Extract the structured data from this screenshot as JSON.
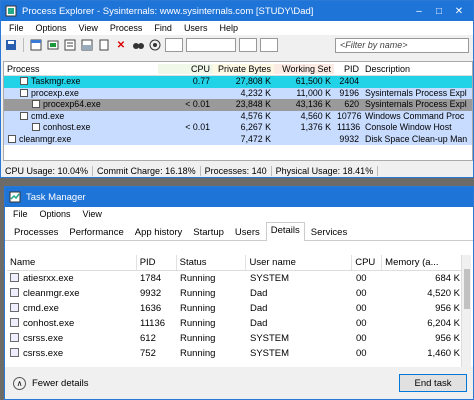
{
  "procexp": {
    "title": "Process Explorer - Sysinternals: www.sysinternals.com [STUDY\\Dad]",
    "menu": [
      "File",
      "Options",
      "View",
      "Process",
      "Find",
      "Users",
      "Help"
    ],
    "filter_placeholder": "<Filter by name>",
    "columns": [
      "Process",
      "CPU",
      "Private Bytes",
      "Working Set",
      "PID",
      "Description"
    ],
    "rows": [
      {
        "name": "Taskmgr.exe",
        "cpu": "0.77",
        "priv": "27,808 K",
        "ws": "61,500 K",
        "pid": "2404",
        "desc": "",
        "bg": "#22d3e8",
        "indent": 1
      },
      {
        "name": "procexp.exe",
        "cpu": "",
        "priv": "4,232 K",
        "ws": "11,000 K",
        "pid": "9196",
        "desc": "Sysinternals Process Expl",
        "bg": "#c8dcff",
        "indent": 1
      },
      {
        "name": "procexp64.exe",
        "cpu": "< 0.01",
        "priv": "23,848 K",
        "ws": "43,136 K",
        "pid": "620",
        "desc": "Sysinternals Process Expl",
        "bg": "#9a9a9a",
        "indent": 2
      },
      {
        "name": "cmd.exe",
        "cpu": "",
        "priv": "4,576 K",
        "ws": "4,560 K",
        "pid": "10776",
        "desc": "Windows Command Proc",
        "bg": "#c8dcff",
        "indent": 1
      },
      {
        "name": "conhost.exe",
        "cpu": "< 0.01",
        "priv": "6,267 K",
        "ws": "1,376 K",
        "pid": "11136",
        "desc": "Console Window Host",
        "bg": "#c8dcff",
        "indent": 2
      },
      {
        "name": "cleanmgr.exe",
        "cpu": "",
        "priv": "7,472 K",
        "ws": "",
        "pid": "9932",
        "desc": "Disk Space Clean-up Man",
        "bg": "#c8dcff",
        "indent": 0
      }
    ],
    "status": {
      "cpu": "CPU Usage: 10.04%",
      "commit": "Commit Charge: 16.18%",
      "processes": "Processes: 140",
      "physical": "Physical Usage: 18.41%"
    }
  },
  "taskmgr": {
    "title": "Task Manager",
    "menu": [
      "File",
      "Options",
      "View"
    ],
    "tabs": [
      "Processes",
      "Performance",
      "App history",
      "Startup",
      "Users",
      "Details",
      "Services"
    ],
    "active_tab": "Details",
    "columns": [
      "Name",
      "PID",
      "Status",
      "User name",
      "CPU",
      "Memory (a..."
    ],
    "rows": [
      {
        "name": "atiesrxx.exe",
        "pid": "1784",
        "status": "Running",
        "user": "SYSTEM",
        "cpu": "00",
        "mem": "684 K"
      },
      {
        "name": "cleanmgr.exe",
        "pid": "9932",
        "status": "Running",
        "user": "Dad",
        "cpu": "00",
        "mem": "4,520 K"
      },
      {
        "name": "cmd.exe",
        "pid": "1636",
        "status": "Running",
        "user": "Dad",
        "cpu": "00",
        "mem": "956 K"
      },
      {
        "name": "conhost.exe",
        "pid": "11136",
        "status": "Running",
        "user": "Dad",
        "cpu": "00",
        "mem": "6,204 K"
      },
      {
        "name": "csrss.exe",
        "pid": "612",
        "status": "Running",
        "user": "SYSTEM",
        "cpu": "00",
        "mem": "956 K"
      },
      {
        "name": "csrss.exe",
        "pid": "752",
        "status": "Running",
        "user": "SYSTEM",
        "cpu": "00",
        "mem": "1,460 K"
      }
    ],
    "fewer_details": "Fewer details",
    "end_task": "End task"
  }
}
